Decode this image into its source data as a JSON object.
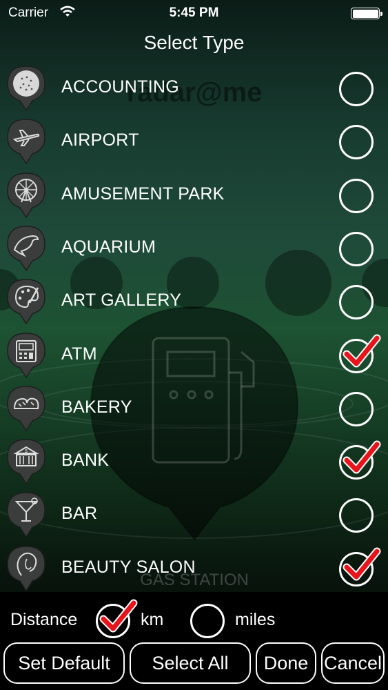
{
  "status_bar": {
    "carrier": "Carrier",
    "time": "5:45 PM"
  },
  "header": {
    "title": "Select Type"
  },
  "background": {
    "logo_text": "radar@me",
    "caption": "GAS STATION"
  },
  "types": [
    {
      "label": "ACCOUNTING",
      "icon": "accounting-icon",
      "checked": false
    },
    {
      "label": "AIRPORT",
      "icon": "airplane-icon",
      "checked": false
    },
    {
      "label": "AMUSEMENT PARK",
      "icon": "ferris-wheel-icon",
      "checked": false
    },
    {
      "label": "AQUARIUM",
      "icon": "dolphin-icon",
      "checked": false
    },
    {
      "label": "ART GALLERY",
      "icon": "palette-icon",
      "checked": false
    },
    {
      "label": "ATM",
      "icon": "atm-icon",
      "checked": true
    },
    {
      "label": "BAKERY",
      "icon": "bread-icon",
      "checked": false
    },
    {
      "label": "BANK",
      "icon": "bank-icon",
      "checked": true
    },
    {
      "label": "BAR",
      "icon": "cocktail-icon",
      "checked": false
    },
    {
      "label": "BEAUTY SALON",
      "icon": "woman-face-icon",
      "checked": true
    }
  ],
  "distance": {
    "label": "Distance",
    "options": [
      {
        "label": "km",
        "selected": true
      },
      {
        "label": "miles",
        "selected": false
      }
    ]
  },
  "buttons": {
    "set_default": "Set Default",
    "select_all": "Select All",
    "done": "Done",
    "cancel": "Cancel"
  },
  "colors": {
    "checkmark": "#e8141c",
    "pin_fill": "#3a3d3c",
    "text": "#ffffff"
  }
}
